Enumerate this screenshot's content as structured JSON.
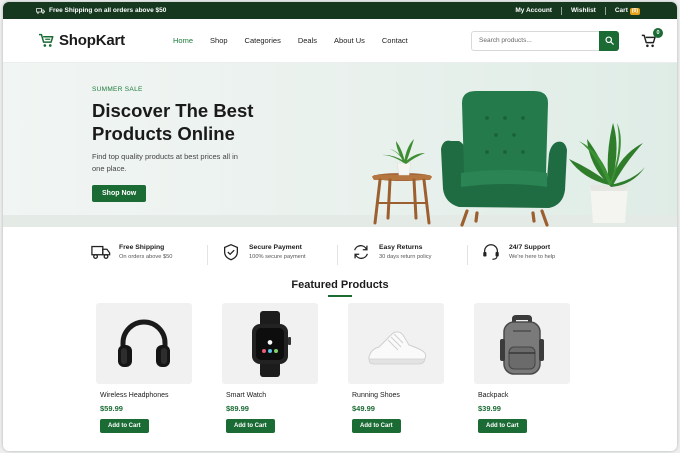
{
  "topbar": {
    "promo_text": "Free Shipping on all orders above $50",
    "links": {
      "account": "My Account",
      "wishlist": "Wishlist",
      "cart": "Cart",
      "cart_count": "(0)"
    }
  },
  "header": {
    "logo_text": "ShopKart",
    "nav": [
      "Home",
      "Shop",
      "Categories",
      "Deals",
      "About Us",
      "Contact"
    ],
    "active_nav": "Home",
    "search": {
      "placeholder": "Search products..."
    },
    "cart_badge": "0"
  },
  "hero": {
    "tag": "SUMMER SALE",
    "title_line1": "Discover The Best",
    "title_line2": "Products Online",
    "description": "Find top quality products at best prices all in one place.",
    "button": "Shop Now"
  },
  "features": [
    {
      "icon": "truck-icon",
      "title": "Free Shipping",
      "subtitle": "On orders above $50"
    },
    {
      "icon": "shield-check-icon",
      "title": "Secure Payment",
      "subtitle": "100% secure payment"
    },
    {
      "icon": "return-icon",
      "title": "Easy Returns",
      "subtitle": "30 days return policy"
    },
    {
      "icon": "headset-icon",
      "title": "24/7 Support",
      "subtitle": "We're here to help"
    }
  ],
  "featured": {
    "title": "Featured Products",
    "products": [
      {
        "name": "Wireless Headphones",
        "price": "$59.99",
        "button": "Add to Cart",
        "icon": "headphones-icon"
      },
      {
        "name": "Smart Watch",
        "price": "$89.99",
        "button": "Add to Cart",
        "icon": "smartwatch-icon"
      },
      {
        "name": "Running Shoes",
        "price": "$49.99",
        "button": "Add to Cart",
        "icon": "sneaker-icon"
      },
      {
        "name": "Backpack",
        "price": "$39.99",
        "button": "Add to Cart",
        "icon": "backpack-icon"
      }
    ]
  },
  "colors": {
    "brand_green": "#1b6b35",
    "topbar_bg": "#15381f",
    "accent_orange": "#e6a21d"
  }
}
